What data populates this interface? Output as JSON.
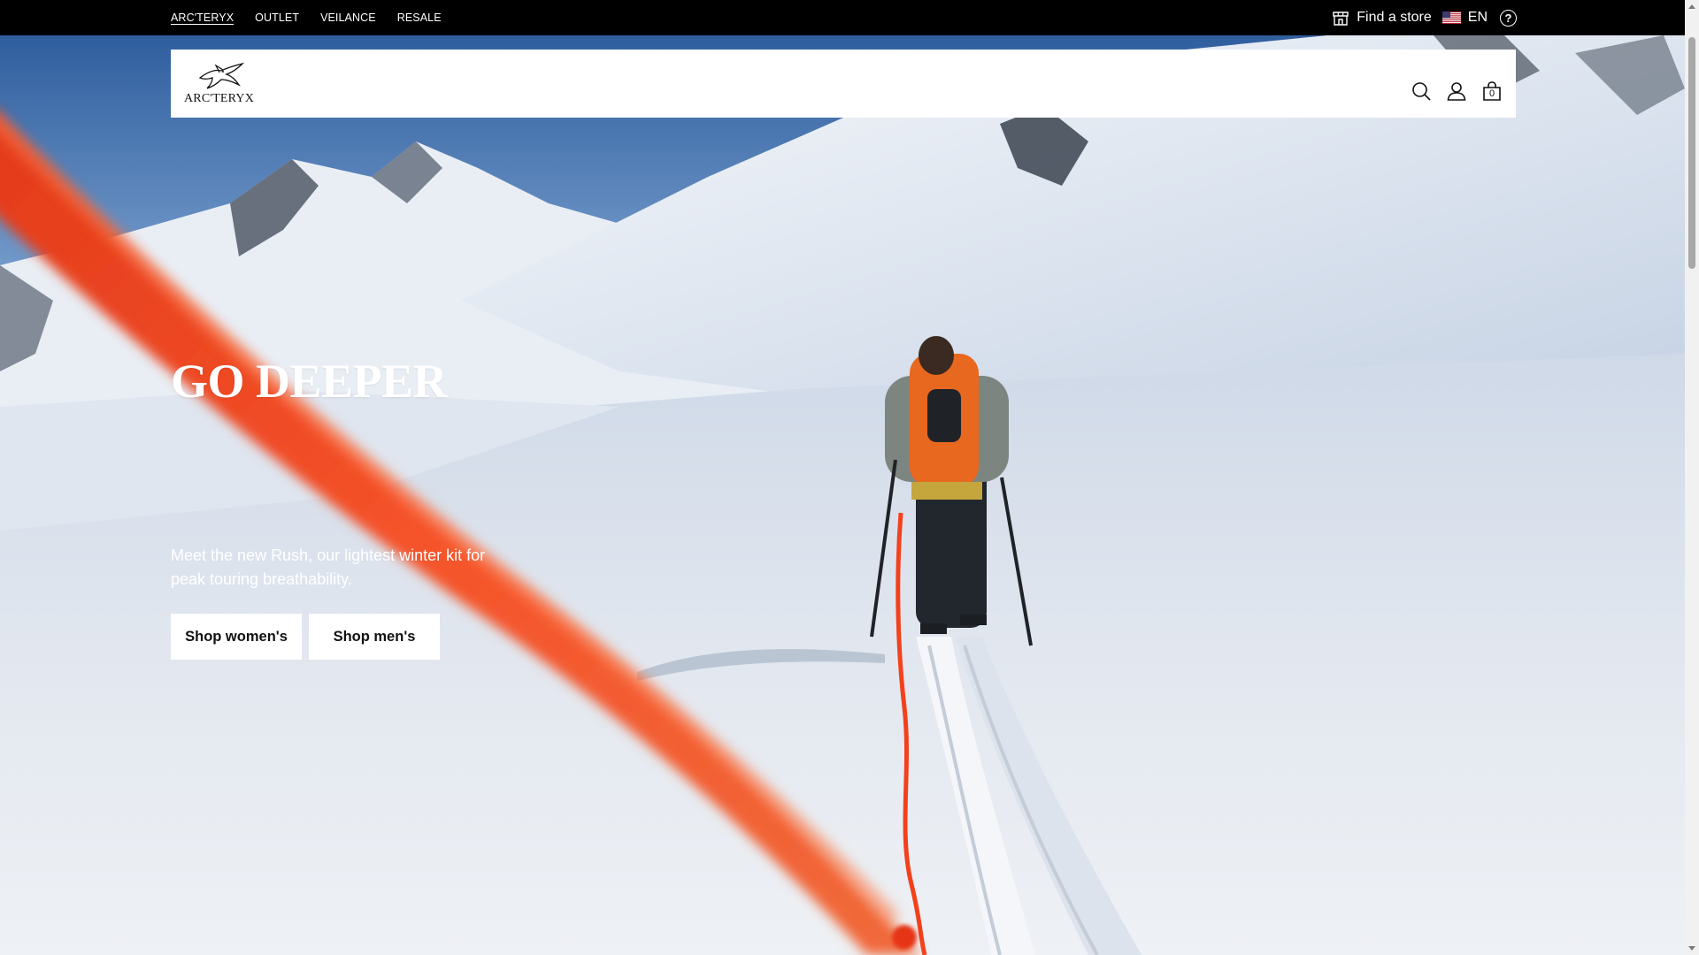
{
  "utility_bar": {
    "brand_links": [
      {
        "label": "ARC'TERYX",
        "active": true
      },
      {
        "label": "OUTLET",
        "active": false
      },
      {
        "label": "VEILANCE",
        "active": false
      },
      {
        "label": "RESALE",
        "active": false
      }
    ],
    "store_label": "Find a store",
    "language": "EN",
    "store_icon": "store-icon",
    "flag_icon": "us-flag-icon",
    "help_icon": "help-icon"
  },
  "header": {
    "logo_text": "ARC'TERYX",
    "icons": [
      "search-icon",
      "account-icon",
      "cart-icon"
    ],
    "cart_count": "0"
  },
  "hero": {
    "title": "GO DEEPER",
    "description": "Meet the new Rush, our lightest winter kit for peak touring breathability.",
    "cta_women": "Shop women's",
    "cta_men": "Shop men's"
  },
  "colors": {
    "accent_rope": "#f2461e",
    "backpack": "#e8681f",
    "sky": "#3f6fae"
  }
}
